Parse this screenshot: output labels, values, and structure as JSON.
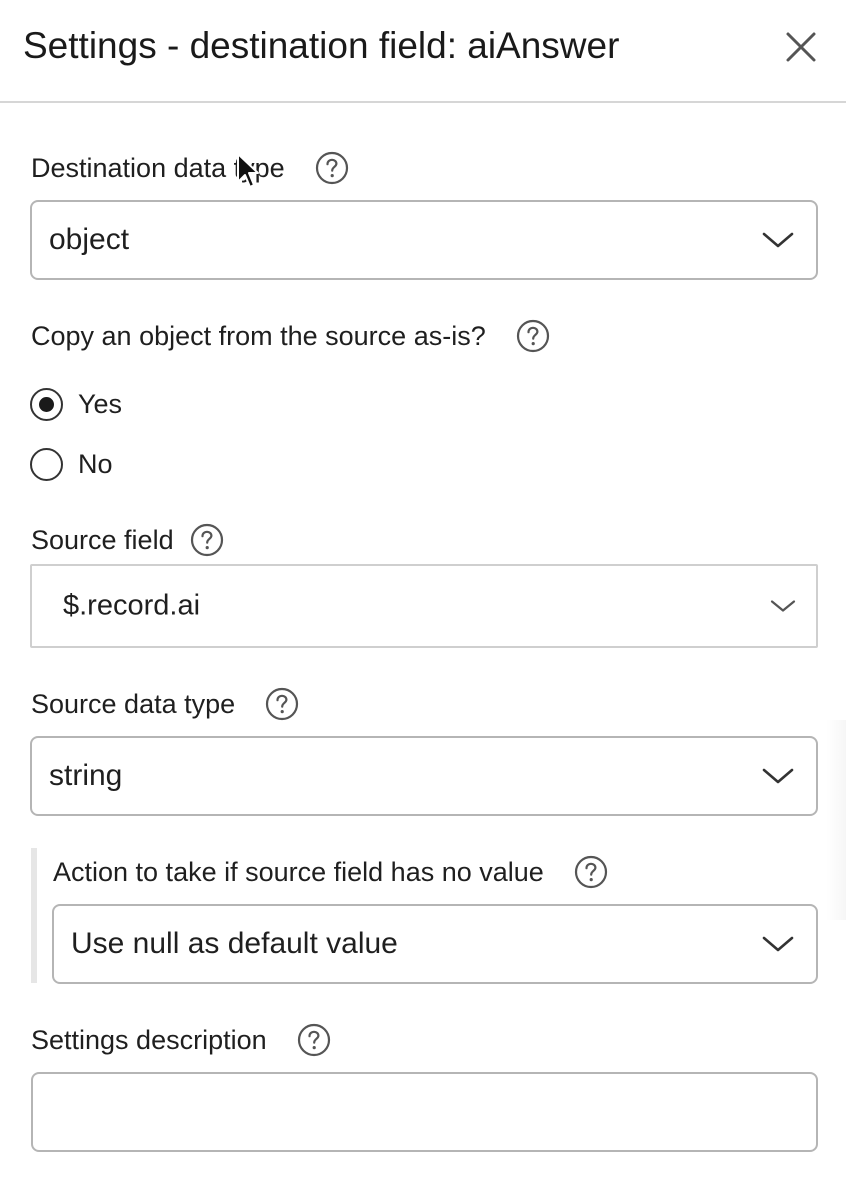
{
  "header": {
    "title": "Settings - destination field: aiAnswer"
  },
  "destination_data_type": {
    "label": "Destination data type",
    "value": "object"
  },
  "copy_object": {
    "label": "Copy an object from the source as-is?",
    "options": [
      {
        "label": "Yes",
        "checked": true
      },
      {
        "label": "No",
        "checked": false
      }
    ]
  },
  "source_field": {
    "label": "Source field",
    "value": "$.record.ai"
  },
  "source_data_type": {
    "label": "Source data type",
    "value": "string"
  },
  "no_value_action": {
    "label": "Action to take if source field has no value",
    "value": "Use null as default value"
  },
  "settings_description": {
    "label": "Settings description",
    "value": ""
  },
  "icons": {
    "close": "close-icon",
    "help": "help-circle-icon",
    "chevron": "chevron-down-icon",
    "cursor": "mouse-pointer-icon"
  }
}
